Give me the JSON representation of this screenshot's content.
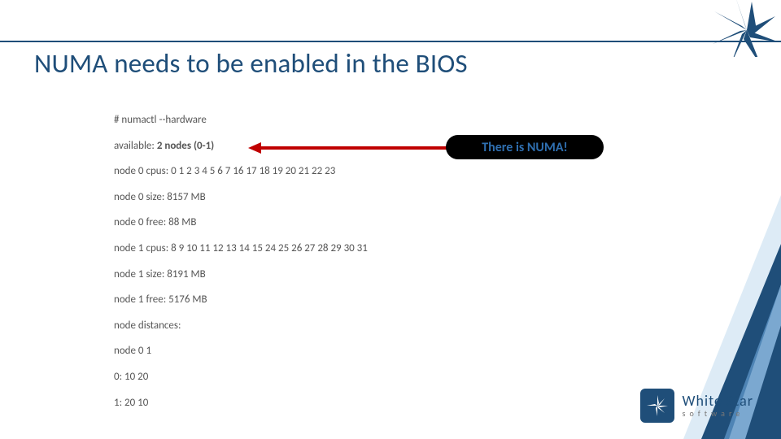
{
  "title": "NUMA needs to be enabled in the BIOS",
  "cmd": "# numactl --hardware",
  "avail_pre": "available: ",
  "avail_bold": "2 nodes (0-1)",
  "callout": "There is NUMA!",
  "lines": {
    "l1": "node 0 cpus: 0 1 2 3 4 5 6 7 16 17 18 19 20 21 22 23",
    "l2": "node 0 size: 8157 MB",
    "l3": "node 0 free: 88 MB",
    "l4": "node 1 cpus: 8 9 10 11 12 13 14 15 24 25 26 27 28 29 30 31",
    "l5": "node 1 size: 8191 MB",
    "l6": "node 1 free: 5176 MB",
    "l7": "node distances:",
    "l8": "node   0     1",
    "l9": "0: 10 20",
    "l10": "1: 20 10"
  },
  "logo": {
    "brand": "White Star",
    "sub": "software"
  }
}
